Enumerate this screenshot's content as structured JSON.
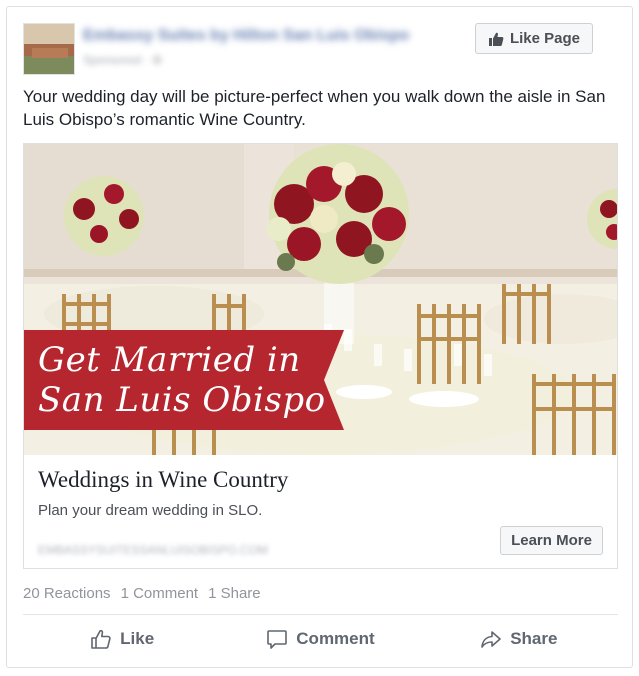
{
  "header": {
    "page_name": "Embassy Suites by Hilton San Luis Obispo",
    "sponsored_label": "Sponsored · ⚙",
    "like_page_label": "Like Page"
  },
  "post": {
    "text": "Your wedding day will be picture-perfect when you walk down the aisle in San Luis Obispo’s romantic Wine Country."
  },
  "creative": {
    "banner_line1": "Get Married in",
    "banner_line2": "San Luis Obispo",
    "title": "Weddings in Wine Country",
    "description": "Plan your dream wedding in SLO.",
    "url": "EMBASSYSUITESSANLUISOBISPO.COM",
    "cta_label": "Learn More",
    "colors": {
      "banner": "#b5262e",
      "rose": "#8f1520",
      "hydrangea": "#e9ecc8",
      "chair": "#b98e4f"
    }
  },
  "stats": {
    "reactions": "20 Reactions",
    "comments": "1 Comment",
    "shares": "1 Share"
  },
  "actions": {
    "like": "Like",
    "comment": "Comment",
    "share": "Share"
  },
  "icons": {
    "like_page": "thumbs-up-icon",
    "like": "thumbs-up-outline-icon",
    "comment": "speech-bubble-icon",
    "share": "share-arrow-icon"
  }
}
